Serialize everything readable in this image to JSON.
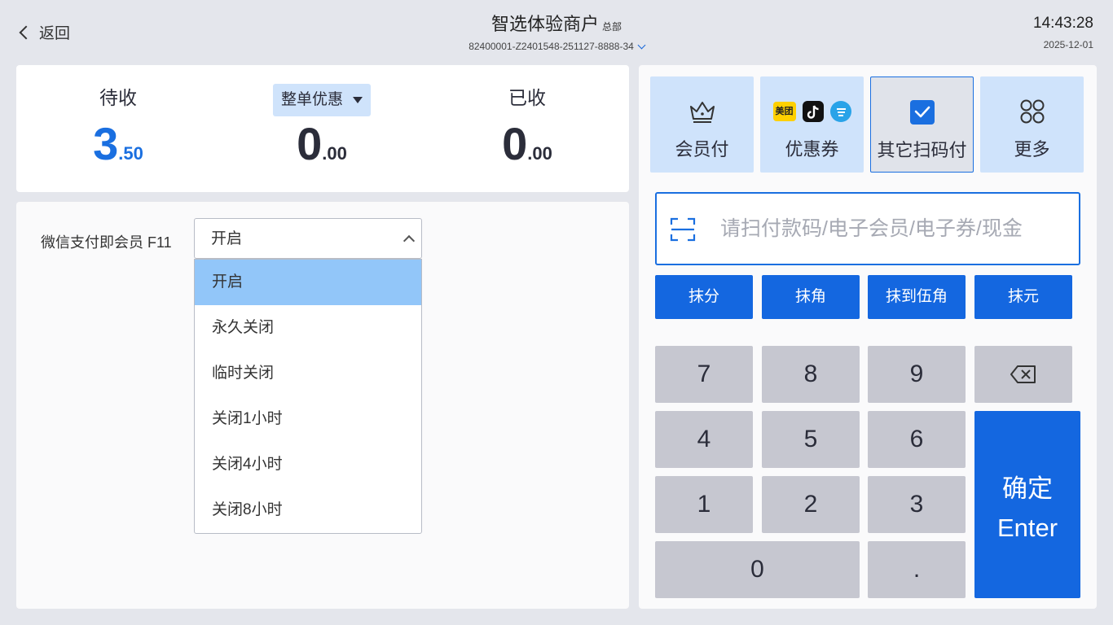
{
  "header": {
    "back_label": "返回",
    "merchant_name": "智选体验商户",
    "merchant_tag": "总部",
    "order_no": "82400001-Z2401548-251127-8888-34",
    "time": "14:43:28",
    "date": "2025-12-01"
  },
  "summary": {
    "pending": {
      "label": "待收",
      "int": "3",
      "dec": ".50"
    },
    "discount": {
      "label": "整单优惠",
      "int": "0",
      "dec": ".00"
    },
    "received": {
      "label": "已收",
      "int": "0",
      "dec": ".00"
    }
  },
  "settings": {
    "label": "微信支付即会员 F11",
    "selected": "开启",
    "options": [
      "开启",
      "永久关闭",
      "临时关闭",
      "关闭1小时",
      "关闭4小时",
      "关闭8小时"
    ]
  },
  "pay_methods": [
    {
      "label": "会员付",
      "icon": "crown-icon"
    },
    {
      "label": "优惠券",
      "icon": "coupon-platform-icons",
      "logo_text": "美团"
    },
    {
      "label": "其它扫码付",
      "icon": "checkbox-checked-icon"
    },
    {
      "label": "更多",
      "icon": "grid-icon"
    }
  ],
  "scan": {
    "placeholder": "请扫付款码/电子会员/电子券/现金"
  },
  "rounding": [
    "抹分",
    "抹角",
    "抹到伍角",
    "抹元"
  ],
  "keypad": {
    "row1": [
      "7",
      "8",
      "9"
    ],
    "row2": [
      "4",
      "5",
      "6"
    ],
    "row3": [
      "1",
      "2",
      "3"
    ],
    "zero": "0",
    "dot": ".",
    "enter_l1": "确定",
    "enter_l2": "Enter"
  },
  "colors": {
    "accent": "#1467e0",
    "tile": "#cfe3fb",
    "key": "#c6c7d0",
    "selected_option": "#92c6f9"
  }
}
